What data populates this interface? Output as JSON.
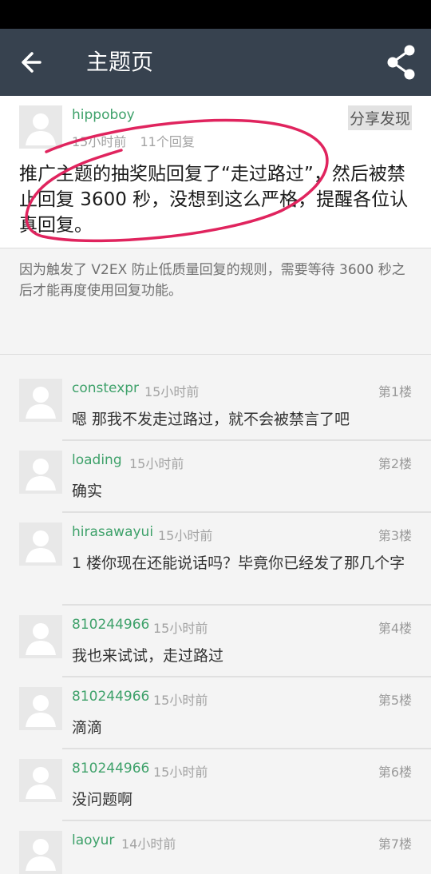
{
  "header": {
    "title": "主题页",
    "back_icon": "arrow-left-icon",
    "share_icon": "share-icon"
  },
  "topic": {
    "author": "hippoboy",
    "time": "15小时前",
    "reply_count": "11个回复",
    "share_discover": "分享发现",
    "title": "推广主题的抽奖贴回复了“走过路过”，然后被禁止回复 3600 秒，没想到这么严格，提醒各位认真回复。",
    "content": "因为触发了 V2EX 防止低质量回复的规则，需要等待 3600 秒之后才能再度使用回复功能。"
  },
  "replies": [
    {
      "name": "constexpr",
      "time": "15小时前",
      "floor": "第1楼",
      "text": "嗯 那我不发走过路过，就不会被禁言了吧"
    },
    {
      "name": "loading",
      "time": "15小时前",
      "floor": "第2楼",
      "text": "确实"
    },
    {
      "name": "hirasawayui",
      "time": "15小时前",
      "floor": "第3楼",
      "text": "1 楼你现在还能说话吗？毕竟你已经发了那几个字"
    },
    {
      "name": "810244966",
      "time": "15小时前",
      "floor": "第4楼",
      "text": "我也来试试，走过路过"
    },
    {
      "name": "810244966",
      "time": "15小时前",
      "floor": "第5楼",
      "text": "滴滴"
    },
    {
      "name": "810244966",
      "time": "15小时前",
      "floor": "第6楼",
      "text": "没问题啊"
    },
    {
      "name": "laoyur",
      "time": "14小时前",
      "floor": "第7楼",
      "text": ""
    }
  ],
  "colors": {
    "appbar": "#37424f",
    "username": "#3ea16a",
    "annotation": "#e0245e"
  }
}
